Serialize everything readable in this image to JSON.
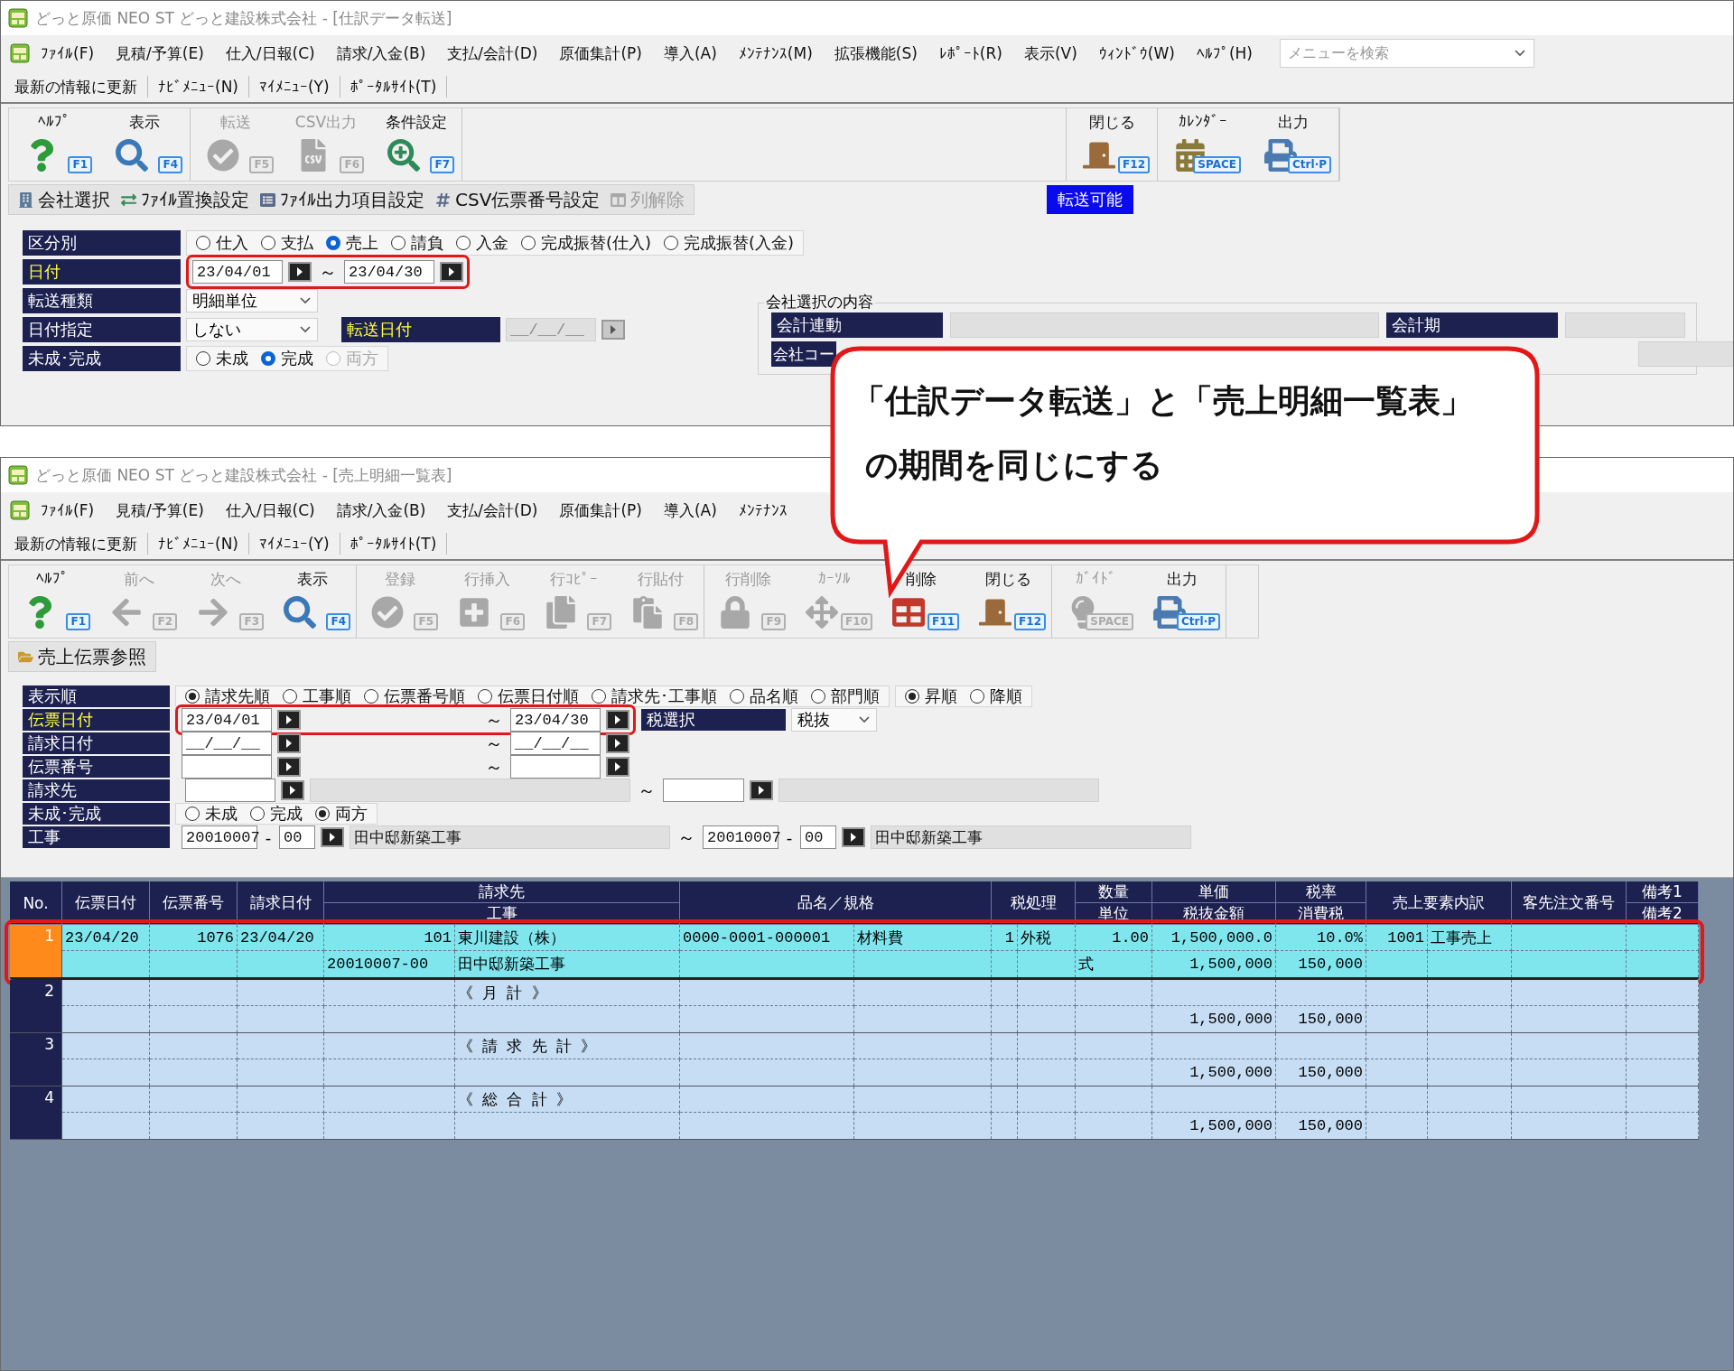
{
  "transfer_window": {
    "title": "どっと原価 NEO ST どっと建設株式会社 - [仕訳データ転送]",
    "menu": [
      "ﾌｧｲﾙ(F)",
      "見積/予算(E)",
      "仕入/日報(C)",
      "請求/入金(B)",
      "支払/会計(D)",
      "原価集計(P)",
      "導入(A)",
      "ﾒﾝﾃﾅﾝｽ(M)",
      "拡張機能(S)",
      "ﾚﾎﾟｰﾄ(R)",
      "表示(V)",
      "ｳｨﾝﾄﾞｳ(W)",
      "ﾍﾙﾌﾟ(H)"
    ],
    "search": {
      "placeholder": "メニューを検索"
    },
    "links": [
      "最新の情報に更新",
      "ﾅﾋﾞﾒﾆｭｰ(N)",
      "ﾏｲﾒﾆｭｰ(Y)",
      "ﾎﾟｰﾀﾙｻｲﾄ(T)"
    ],
    "toolbar": [
      {
        "buttons": [
          {
            "kind": "help",
            "label": "ﾍﾙﾌﾟ",
            "key": "F1",
            "disabled": false
          },
          {
            "kind": "search",
            "label": "表示",
            "key": "F4",
            "disabled": false
          }
        ]
      },
      {
        "buttons": [
          {
            "kind": "ok",
            "label": "転送",
            "key": "F5",
            "disabled": true
          },
          {
            "kind": "csv",
            "label": "CSV出力",
            "key": "F6",
            "disabled": true
          },
          {
            "kind": "condition",
            "label": "条件設定",
            "key": "F7",
            "disabled": false
          }
        ]
      },
      {
        "buttons": [
          {
            "kind": "door",
            "label": "閉じる",
            "key": "F12",
            "disabled": false
          }
        ]
      },
      {
        "buttons": [
          {
            "kind": "calendar",
            "label": "ｶﾚﾝﾀﾞｰ",
            "key": "SPACE",
            "disabled": false
          },
          {
            "kind": "printer",
            "label": "出力",
            "key": "Ctrl·P",
            "disabled": false
          }
        ]
      }
    ],
    "subtoolbar": [
      {
        "kind": "company",
        "label": "会社選択",
        "disabled": false
      },
      {
        "kind": "replace",
        "label": "ﾌｧｲﾙ置換設定",
        "disabled": false
      },
      {
        "kind": "output_items",
        "label": "ﾌｧｲﾙ出力項目設定",
        "disabled": false
      },
      {
        "kind": "number",
        "label": "CSV伝票番号設定",
        "disabled": false
      },
      {
        "kind": "columns",
        "label": "列解除",
        "disabled": true
      }
    ],
    "status": "転送可能",
    "form": {
      "rows": [
        {
          "kind": "radios",
          "label": "区分別",
          "highlighted": false,
          "groups": [
            {
              "options": [
                {
                  "label": "仕入",
                  "selected": false,
                  "disabled": false
                },
                {
                  "label": "支払",
                  "selected": false,
                  "disabled": false
                },
                {
                  "label": "売上",
                  "selected": true,
                  "disabled": false
                },
                {
                  "label": "請負",
                  "selected": false,
                  "disabled": false
                },
                {
                  "label": "入金",
                  "selected": false,
                  "disabled": false
                },
                {
                  "label": "完成振替(仕入)",
                  "selected": false,
                  "disabled": false
                },
                {
                  "label": "完成振替(入金)",
                  "selected": false,
                  "disabled": false
                }
              ]
            }
          ]
        },
        {
          "kind": "date_range",
          "label": "日付",
          "highlighted": true,
          "annotated": true,
          "from": "23/04/01",
          "separator": "～",
          "to": "23/04/30"
        },
        {
          "kind": "select",
          "label": "転送種類",
          "highlighted": false,
          "value": "明細単位"
        },
        {
          "kind": "select_date",
          "label": "日付指定",
          "highlighted": false,
          "value": "しない",
          "extra_label": "転送日付",
          "extra_highlighted": true,
          "date": "__/__/__",
          "date_disabled": true
        },
        {
          "kind": "radios",
          "label": "未成･完成",
          "highlighted": false,
          "groups": [
            {
              "options": [
                {
                  "label": "未成",
                  "selected": false,
                  "disabled": false
                },
                {
                  "label": "完成",
                  "selected": true,
                  "disabled": false
                },
                {
                  "label": "両方",
                  "selected": false,
                  "disabled": true
                }
              ]
            }
          ]
        }
      ],
      "company_group": {
        "title": "会社選択の内容",
        "fields": [
          {
            "label": "会計連動"
          },
          {
            "label": "会計期"
          },
          {
            "label": "会社コー"
          }
        ]
      }
    }
  },
  "list_window": {
    "title": "どっと原価 NEO ST どっと建設株式会社 - [売上明細一覧表]",
    "menu": [
      "ﾌｧｲﾙ(F)",
      "見積/予算(E)",
      "仕入/日報(C)",
      "請求/入金(B)",
      "支払/会計(D)",
      "原価集計(P)",
      "導入(A)",
      "ﾒﾝﾃﾅﾝｽ"
    ],
    "links": [
      "最新の情報に更新",
      "ﾅﾋﾞﾒﾆｭｰ(N)",
      "ﾏｲﾒﾆｭｰ(Y)",
      "ﾎﾟｰﾀﾙｻｲﾄ(T)"
    ],
    "toolbar": [
      {
        "buttons": [
          {
            "kind": "help",
            "label": "ﾍﾙﾌﾟ",
            "key": "F1",
            "disabled": false
          },
          {
            "kind": "prev",
            "label": "前へ",
            "key": "F2",
            "disabled": true
          },
          {
            "kind": "next",
            "label": "次へ",
            "key": "F3",
            "disabled": true
          },
          {
            "kind": "search",
            "label": "表示",
            "key": "F4",
            "disabled": false
          }
        ]
      },
      {
        "buttons": [
          {
            "kind": "ok",
            "label": "登録",
            "key": "F5",
            "disabled": true
          },
          {
            "kind": "insert",
            "label": "行挿入",
            "key": "F6",
            "disabled": true
          },
          {
            "kind": "copy",
            "label": "行ｺﾋﾟｰ",
            "key": "F7",
            "disabled": true
          },
          {
            "kind": "paste",
            "label": "行貼付",
            "key": "F8",
            "disabled": true
          }
        ]
      },
      {
        "buttons": [
          {
            "kind": "lock",
            "label": "行削除",
            "key": "F9",
            "disabled": true
          },
          {
            "kind": "cursor",
            "label": "ｶｰｿﾙ",
            "key": "F10",
            "disabled": true
          },
          {
            "kind": "table",
            "label": "削除",
            "key": "F11",
            "disabled": false
          },
          {
            "kind": "door",
            "label": "閉じる",
            "key": "F12",
            "disabled": false
          }
        ]
      },
      {
        "buttons": [
          {
            "kind": "guide",
            "label": "ｶﾞｲﾄﾞ",
            "key": "SPACE",
            "disabled": true
          },
          {
            "kind": "printer",
            "label": "出力",
            "key": "Ctrl·P",
            "disabled": false
          }
        ]
      }
    ],
    "subtoolbar": [
      {
        "kind": "slip",
        "label": "売上伝票参照",
        "disabled": false
      }
    ],
    "form": {
      "rows": [
        {
          "kind": "radios",
          "label": "表示順",
          "highlighted": false,
          "groups": [
            {
              "options": [
                {
                  "label": "請求先順",
                  "selected": true,
                  "disabled": false
                },
                {
                  "label": "工事順",
                  "selected": false,
                  "disabled": false
                },
                {
                  "label": "伝票番号順",
                  "selected": false,
                  "disabled": false
                },
                {
                  "label": "伝票日付順",
                  "selected": false,
                  "disabled": false
                },
                {
                  "label": "請求先･工事順",
                  "selected": false,
                  "disabled": false
                },
                {
                  "label": "品名順",
                  "selected": false,
                  "disabled": false
                },
                {
                  "label": "部門順",
                  "selected": false,
                  "disabled": false
                }
              ]
            },
            {
              "options": [
                {
                  "label": "昇順",
                  "selected": true,
                  "disabled": false
                },
                {
                  "label": "降順",
                  "selected": false,
                  "disabled": false
                }
              ]
            }
          ]
        },
        {
          "kind": "range",
          "label": "伝票日付",
          "highlighted": true,
          "annotated": true,
          "from": "23/04/01",
          "separator": "～",
          "to": "23/04/30",
          "tax_label": "税選択",
          "tax_value": "税抜"
        },
        {
          "kind": "range",
          "label": "請求日付",
          "highlighted": false,
          "annotated": false,
          "from": "__/__/__",
          "separator": "～",
          "to": "__/__/__"
        },
        {
          "kind": "range",
          "label": "伝票番号",
          "highlighted": false,
          "annotated": false,
          "separator": "～"
        },
        {
          "kind": "customer",
          "label": "請求先",
          "highlighted": false,
          "separator": "～"
        },
        {
          "kind": "radios",
          "label": "未成･完成",
          "highlighted": false,
          "groups": [
            {
              "options": [
                {
                  "label": "未成",
                  "selected": false,
                  "disabled": false
                },
                {
                  "label": "完成",
                  "selected": false,
                  "disabled": false
                },
                {
                  "label": "両方",
                  "selected": true,
                  "disabled": false
                }
              ]
            }
          ]
        },
        {
          "kind": "site",
          "label": "工事",
          "highlighted": false,
          "from": {
            "code": "20010007",
            "dash": "-",
            "branch": "00",
            "name": "田中邸新築工事"
          },
          "separator": "～",
          "to": {
            "code": "20010007",
            "dash": "-",
            "branch": "00",
            "name": "田中邸新築工事"
          }
        }
      ]
    },
    "table": {
      "header": [
        {
          "label": "No."
        },
        {
          "label": "伝票日付"
        },
        {
          "label": "伝票番号"
        },
        {
          "label": "請求日付"
        },
        {
          "label": "請求先",
          "sub": "工事"
        },
        {
          "label": "品名／規格"
        },
        {
          "label": "税処理"
        },
        {
          "label": "数量",
          "sub": "単位"
        },
        {
          "label": "単価",
          "sub": "税抜金額"
        },
        {
          "label": "税率",
          "sub": "消費税"
        },
        {
          "label": "売上要素内訳"
        },
        {
          "label": "客先注文番号"
        },
        {
          "label": "備考1",
          "sub": "備考2"
        }
      ],
      "rows": [
        {
          "no": "1",
          "selected": true,
          "annotated": true,
          "line1": {
            "slip_date": "23/04/20",
            "slip_no": "1076",
            "bill_date": "23/04/20",
            "customer_code": "101",
            "customer_name": "東川建設（株）",
            "item_code": "0000-0001-000001",
            "item_name": "材料費",
            "tax_code": "1",
            "tax_name": "外税",
            "quantity": "1.00",
            "unit_price": "1,500,000.0",
            "tax_rate": "10.0%",
            "sales_code": "1001",
            "sales_name": "工事売上"
          },
          "line2": {
            "site_code": "20010007-00",
            "site_name": "田中邸新築工事",
            "unit": "式",
            "net_amount": "1,500,000",
            "tax_amount": "150,000"
          }
        },
        {
          "no": "2",
          "selected": false,
          "annotated": false,
          "line1": {
            "customer_name": "《 月 計 》"
          },
          "line2": {
            "net_amount": "1,500,000",
            "tax_amount": "150,000"
          }
        },
        {
          "no": "3",
          "selected": false,
          "annotated": false,
          "line1": {
            "customer_name": "《 請 求 先 計 》"
          },
          "line2": {
            "net_amount": "1,500,000",
            "tax_amount": "150,000"
          }
        },
        {
          "no": "4",
          "selected": false,
          "annotated": false,
          "line1": {
            "customer_name": "《 総 合 計 》"
          },
          "line2": {
            "net_amount": "1,500,000",
            "tax_amount": "150,000"
          }
        }
      ]
    }
  },
  "callout": {
    "lines": [
      "「仕訳データ転送」と「売上明細一覧表」",
      "の期間を同じにする"
    ]
  }
}
